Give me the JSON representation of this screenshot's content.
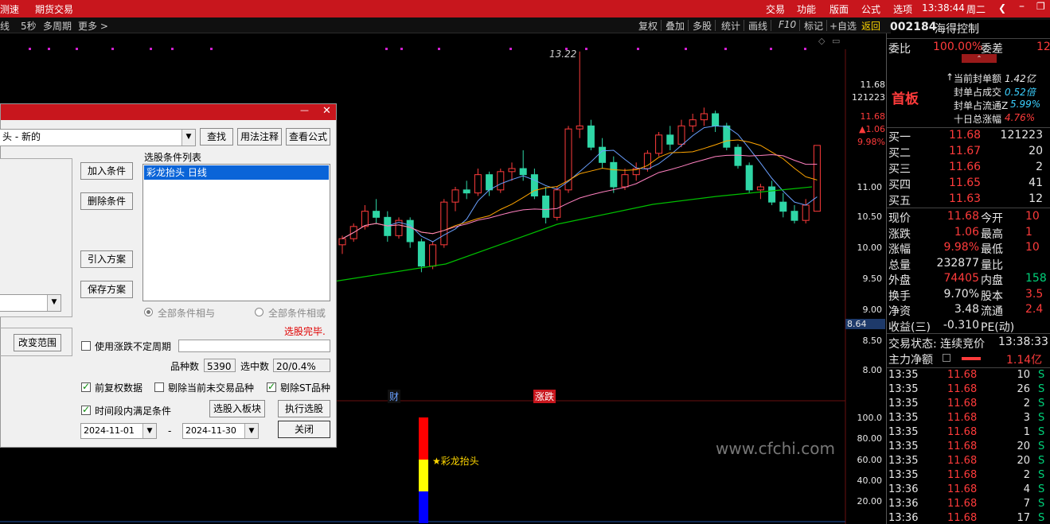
{
  "topbar": {
    "left_items": [
      "测速",
      "期货交易"
    ],
    "right_items": [
      "交易",
      "功能",
      "版面",
      "公式",
      "选项"
    ],
    "clock": "13:38:44",
    "weekday": "周二"
  },
  "toolbar": {
    "left_items": [
      "线",
      "5秒",
      "多周期",
      "更多 >"
    ],
    "right_items": [
      "复权",
      "叠加",
      "多股",
      "统计",
      "画线",
      "F10",
      "标记",
      "+自选",
      "返回"
    ]
  },
  "stock": {
    "code": "002184",
    "name": "海得控制"
  },
  "chart": {
    "peak_label": "13.22",
    "price_axis": [
      "11.68",
      "121223",
      "11.68",
      "▲1.06",
      "9.98%",
      "11.00",
      "10.50",
      "10.00",
      "9.50",
      "9.00",
      "8.64",
      "8.50",
      "8.00"
    ],
    "markers": {
      "cai": "财",
      "zhangdie": "涨跌"
    },
    "indicator_axis": [
      "100.0",
      "80.00",
      "60.00",
      "40.00",
      "20.00"
    ],
    "indicator_label": "★彩龙抬头",
    "watermark": "www.cfchi.com",
    "colors": {
      "up": "#ff3b3b",
      "down": "#2fd6a6",
      "ma5": "#6aa0ff",
      "ma10": "#ffa500",
      "ma20": "#ff80c0",
      "ma60": "#00c000"
    }
  },
  "right_panel": {
    "weibi_label": "委比",
    "weibi_value": "100.00%",
    "weicha_label": "委差",
    "weicha_value": "12.",
    "board_label": "首板",
    "info": [
      {
        "label": "当前封单额",
        "value": "1.42亿"
      },
      {
        "label": "封单占成交",
        "value": "0.52倍"
      },
      {
        "label": "封单占流通Z",
        "value": "5.99%"
      },
      {
        "label": "十日总涨幅",
        "value": "4.76%"
      }
    ],
    "bids": [
      {
        "label": "买一",
        "price": "11.68",
        "vol": "121223"
      },
      {
        "label": "买二",
        "price": "11.67",
        "vol": "20"
      },
      {
        "label": "买三",
        "price": "11.66",
        "vol": "2"
      },
      {
        "label": "买四",
        "price": "11.65",
        "vol": "41"
      },
      {
        "label": "买五",
        "price": "11.63",
        "vol": "12"
      }
    ],
    "quotes": [
      {
        "l1": "现价",
        "v1": "11.68",
        "l2": "今开",
        "v2": "10"
      },
      {
        "l1": "涨跌",
        "v1": "1.06",
        "l2": "最高",
        "v2": "1"
      },
      {
        "l1": "涨幅",
        "v1": "9.98%",
        "l2": "最低",
        "v2": "10"
      },
      {
        "l1": "总量",
        "v1": "232877",
        "l2": "量比",
        "v2": ""
      },
      {
        "l1": "外盘",
        "v1": "74405",
        "l2": "内盘",
        "v2": "158"
      },
      {
        "l1": "换手",
        "v1": "9.70%",
        "l2": "股本",
        "v2": "3.5"
      },
      {
        "l1": "净资",
        "v1": "3.48",
        "l2": "流通",
        "v2": "2.4"
      },
      {
        "l1": "收益(三)",
        "v1": "-0.310",
        "l2": "PE(动)",
        "v2": ""
      }
    ],
    "status_label": "交易状态: 连续竞价",
    "status_time": "13:38:33",
    "main_net_label": "主力净额",
    "main_net_value": "1.14亿",
    "ticks": [
      {
        "time": "13:35",
        "price": "11.68",
        "vol": "10",
        "side": "S"
      },
      {
        "time": "13:35",
        "price": "11.68",
        "vol": "26",
        "side": "S"
      },
      {
        "time": "13:35",
        "price": "11.68",
        "vol": "2",
        "side": "S"
      },
      {
        "time": "13:35",
        "price": "11.68",
        "vol": "3",
        "side": "S"
      },
      {
        "time": "13:35",
        "price": "11.68",
        "vol": "1",
        "side": "S"
      },
      {
        "time": "13:35",
        "price": "11.68",
        "vol": "20",
        "side": "S"
      },
      {
        "time": "13:35",
        "price": "11.68",
        "vol": "20",
        "side": "S"
      },
      {
        "time": "13:35",
        "price": "11.68",
        "vol": "2",
        "side": "S"
      },
      {
        "time": "13:36",
        "price": "11.68",
        "vol": "4",
        "side": "S"
      },
      {
        "time": "13:36",
        "price": "11.68",
        "vol": "7",
        "side": "S"
      },
      {
        "time": "13:36",
        "price": "11.68",
        "vol": "17",
        "side": "S"
      }
    ]
  },
  "dialog": {
    "formula_value": "头 - 新的",
    "btn_find": "查找",
    "btn_usage": "用法注释",
    "btn_view": "查看公式",
    "list_title": "选股条件列表",
    "list_items": [
      "彩龙抬头  日线"
    ],
    "btn_add": "加入条件",
    "btn_delete": "删除条件",
    "btn_import": "引入方案",
    "btn_save": "保存方案",
    "radio_and": "全部条件相与",
    "radio_or": "全部条件相或",
    "status_done": "选股完毕.",
    "btn_change_range": "改变范围",
    "chk_period": "使用涨跌不定周期",
    "count_label": "品种数",
    "count_value": "5390",
    "selected_label": "选中数",
    "selected_value": "20/0.4%",
    "chk_fuquan": "前复权数据",
    "chk_exclude_untraded": "剔除当前未交易品种",
    "chk_exclude_st": "剔除ST品种",
    "chk_timerange": "时间段内满足条件",
    "btn_to_block": "选股入板块",
    "btn_execute": "执行选股",
    "date_from": "2024-11-01",
    "date_sep": "-",
    "date_to": "2024-11-30",
    "btn_close": "关闭"
  }
}
